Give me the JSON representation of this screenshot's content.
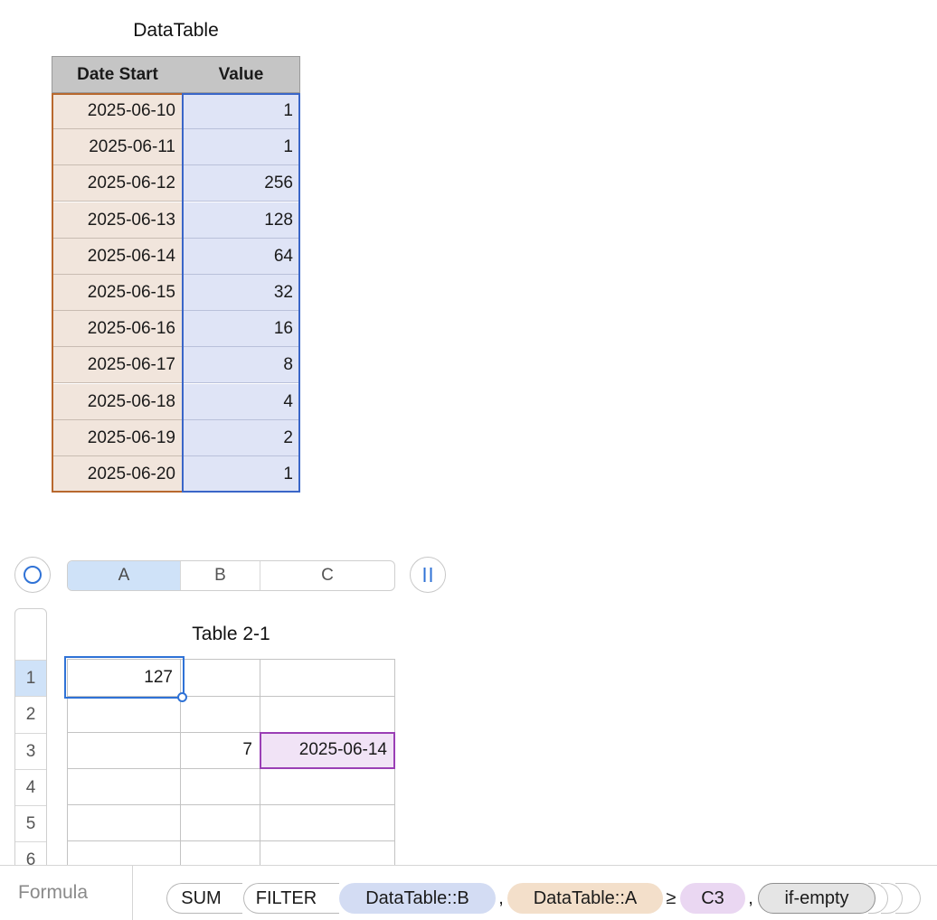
{
  "data_table": {
    "title": "DataTable",
    "headers": [
      "Date Start",
      "Value"
    ],
    "rows": [
      [
        "2025-06-10",
        "1"
      ],
      [
        "2025-06-11",
        "1"
      ],
      [
        "2025-06-12",
        "256"
      ],
      [
        "2025-06-13",
        "128"
      ],
      [
        "2025-06-14",
        "64"
      ],
      [
        "2025-06-15",
        "32"
      ],
      [
        "2025-06-16",
        "16"
      ],
      [
        "2025-06-17",
        "8"
      ],
      [
        "2025-06-18",
        "4"
      ],
      [
        "2025-06-19",
        "2"
      ],
      [
        "2025-06-20",
        "1"
      ]
    ]
  },
  "table2": {
    "title": "Table 2-1",
    "columns": [
      "A",
      "B",
      "C"
    ],
    "selected_column": "A",
    "row_numbers": [
      "1",
      "2",
      "3",
      "4",
      "5",
      "6"
    ],
    "selected_row": "1",
    "cells": [
      [
        "127",
        "",
        ""
      ],
      [
        "",
        "",
        ""
      ],
      [
        "",
        "7",
        "2025-06-14"
      ],
      [
        "",
        "",
        ""
      ],
      [
        "",
        "",
        ""
      ],
      [
        "",
        "",
        ""
      ]
    ]
  },
  "formula_bar": {
    "label": "Formula",
    "tokens": {
      "sum": "SUM",
      "filter": "FILTER",
      "ref_b": "DataTable::B",
      "comma1": ",",
      "ref_a": "DataTable::A",
      "operator": "≥",
      "ref_c3": "C3",
      "comma2": ",",
      "if_empty": "if-empty"
    }
  },
  "colors": {
    "accent_blue": "#2f72d6",
    "ref_a_color": "#b8682e",
    "ref_b_color": "#3a66c8",
    "ref_c3_color": "#9a3fb5",
    "header_gray": "#c5c5c5"
  },
  "icons": {
    "table_select": "circle-icon",
    "table_pause": "pause-bars-icon"
  }
}
